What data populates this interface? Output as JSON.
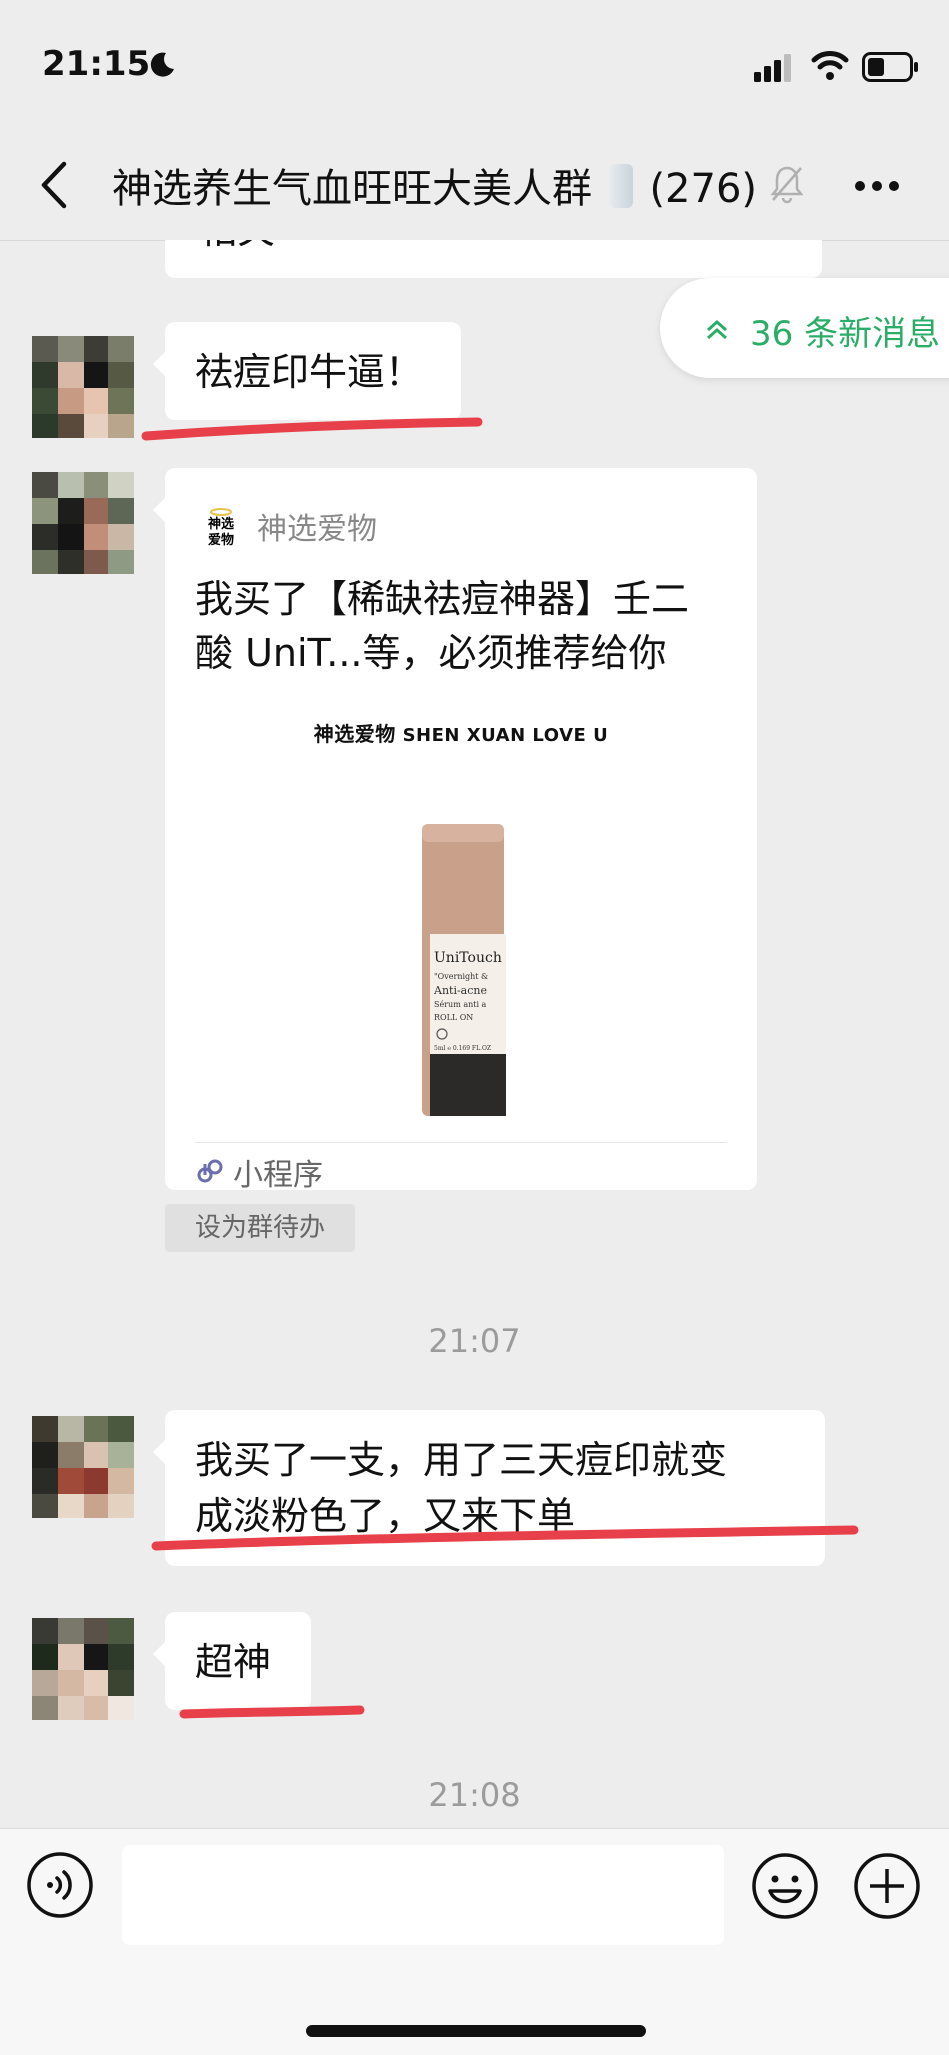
{
  "status_bar": {
    "time": "21:15",
    "icons": [
      "moon-icon",
      "signal-icon",
      "wifi-icon",
      "battery-icon"
    ]
  },
  "header": {
    "title": "神选养生气血旺旺大美人群",
    "member_count": "(276)",
    "icons": [
      "back-icon",
      "mute-bell-icon",
      "more-icon"
    ]
  },
  "new_messages": {
    "label": "36 条新消息",
    "icon": "double-chevron-up-icon",
    "color": "#2aae67"
  },
  "messages": [
    {
      "type": "text",
      "partial_text": "相关",
      "underlined": false
    },
    {
      "type": "text",
      "text": "祛痘印牛逼！",
      "underlined": true
    },
    {
      "type": "mini_program_card",
      "source": "神选爱物",
      "title": "我买了【稀缺祛痘神器】壬二酸 UniT...等，必须推荐给你",
      "brand_cn": "神选爱物",
      "brand_en": "SHEN XUAN LOVE U",
      "product_label": [
        "UniTouch",
        "\"Overnight &",
        "Anti-acne",
        "Sérum anti a",
        "ROLL ON",
        "5ml ℮ 0.169 FL.OZ"
      ],
      "footer_label": "小程序",
      "action_chip": "设为群待办"
    },
    {
      "type": "timestamp",
      "text": "21:07"
    },
    {
      "type": "text",
      "lines": [
        "我买了一支，用了三天痘印就变",
        "成淡粉色了，又来下单"
      ],
      "underlined": true
    },
    {
      "type": "text",
      "text": "超神",
      "underlined": true
    },
    {
      "type": "timestamp",
      "text": "21:08"
    }
  ],
  "input_bar": {
    "value": "",
    "placeholder": "",
    "icons": [
      "voice-icon",
      "emoji-icon",
      "plus-icon"
    ]
  },
  "colors": {
    "background": "#ededed",
    "bubble": "#ffffff",
    "underline": "#e8404a",
    "timestamp": "#9b9b9b",
    "accent_green": "#2aae67"
  }
}
